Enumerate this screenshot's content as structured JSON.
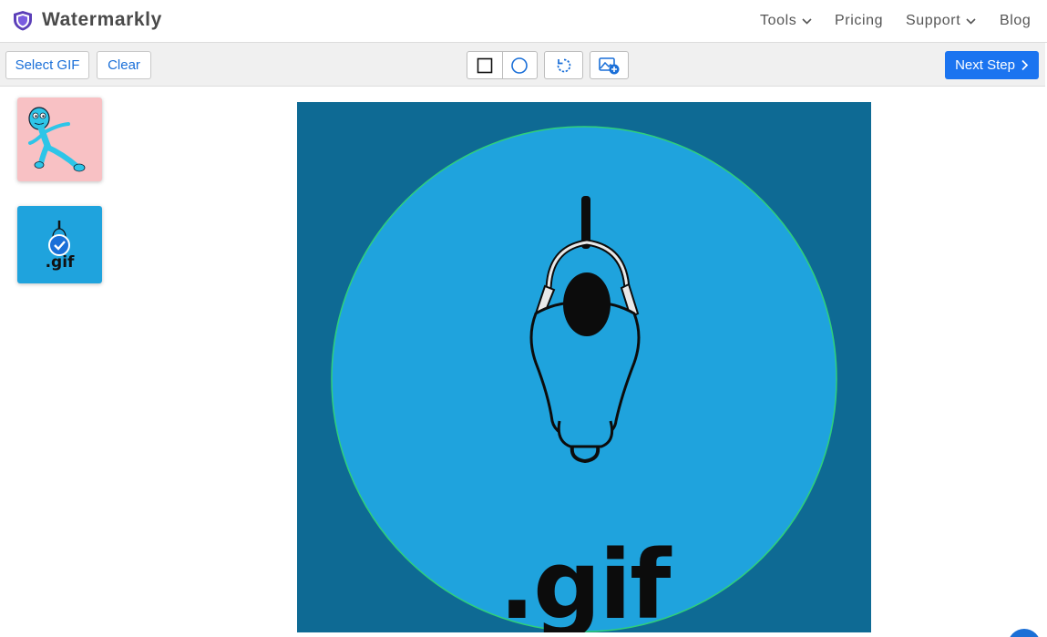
{
  "header": {
    "brand": "Watermarkly",
    "nav": [
      {
        "label": "Tools",
        "has_dropdown": true
      },
      {
        "label": "Pricing",
        "has_dropdown": false
      },
      {
        "label": "Support",
        "has_dropdown": true
      },
      {
        "label": "Blog",
        "has_dropdown": false
      }
    ]
  },
  "toolbar": {
    "select_label": "Select GIF",
    "clear_label": "Clear",
    "tools": [
      "crop-rectangle-icon",
      "crop-circle-icon",
      "rotate-icon",
      "add-image-icon"
    ],
    "next_label": "Next Step"
  },
  "thumbnails": [
    {
      "name": "cartoon-character",
      "background": "#f8c1c4",
      "selected": false
    },
    {
      "name": "gif-icon",
      "label": ".gif",
      "background": "#1fa3dd",
      "selected": true
    }
  ],
  "canvas": {
    "image_text": ".gif",
    "background": "#0e6a94",
    "circle_fill": "#1fa3dd",
    "circle_stroke": "#2fd07a"
  },
  "colors": {
    "accent": "#1b74f0",
    "link": "#1a6fd8"
  }
}
